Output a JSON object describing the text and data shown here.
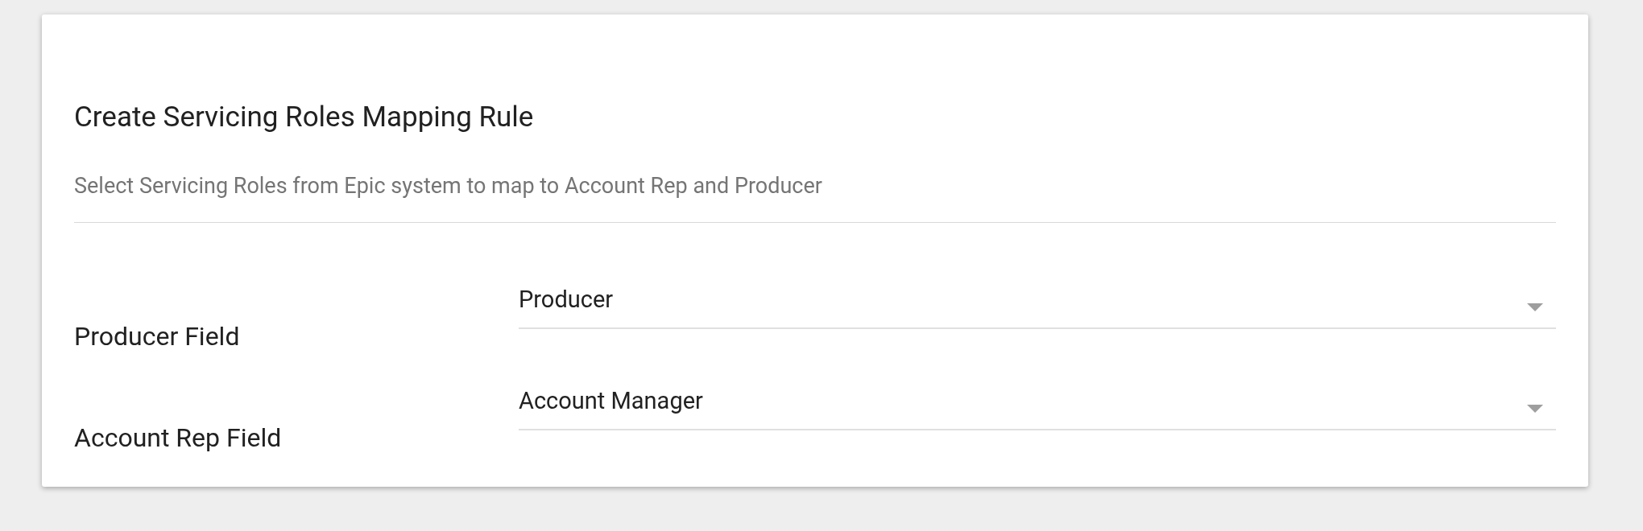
{
  "card": {
    "title": "Create Servicing Roles Mapping Rule",
    "subtitle": "Select Servicing Roles from Epic system to map to Account Rep and Producer"
  },
  "fields": [
    {
      "label": "Producer Field",
      "value": "Producer"
    },
    {
      "label": "Account Rep Field",
      "value": "Account Manager"
    }
  ]
}
